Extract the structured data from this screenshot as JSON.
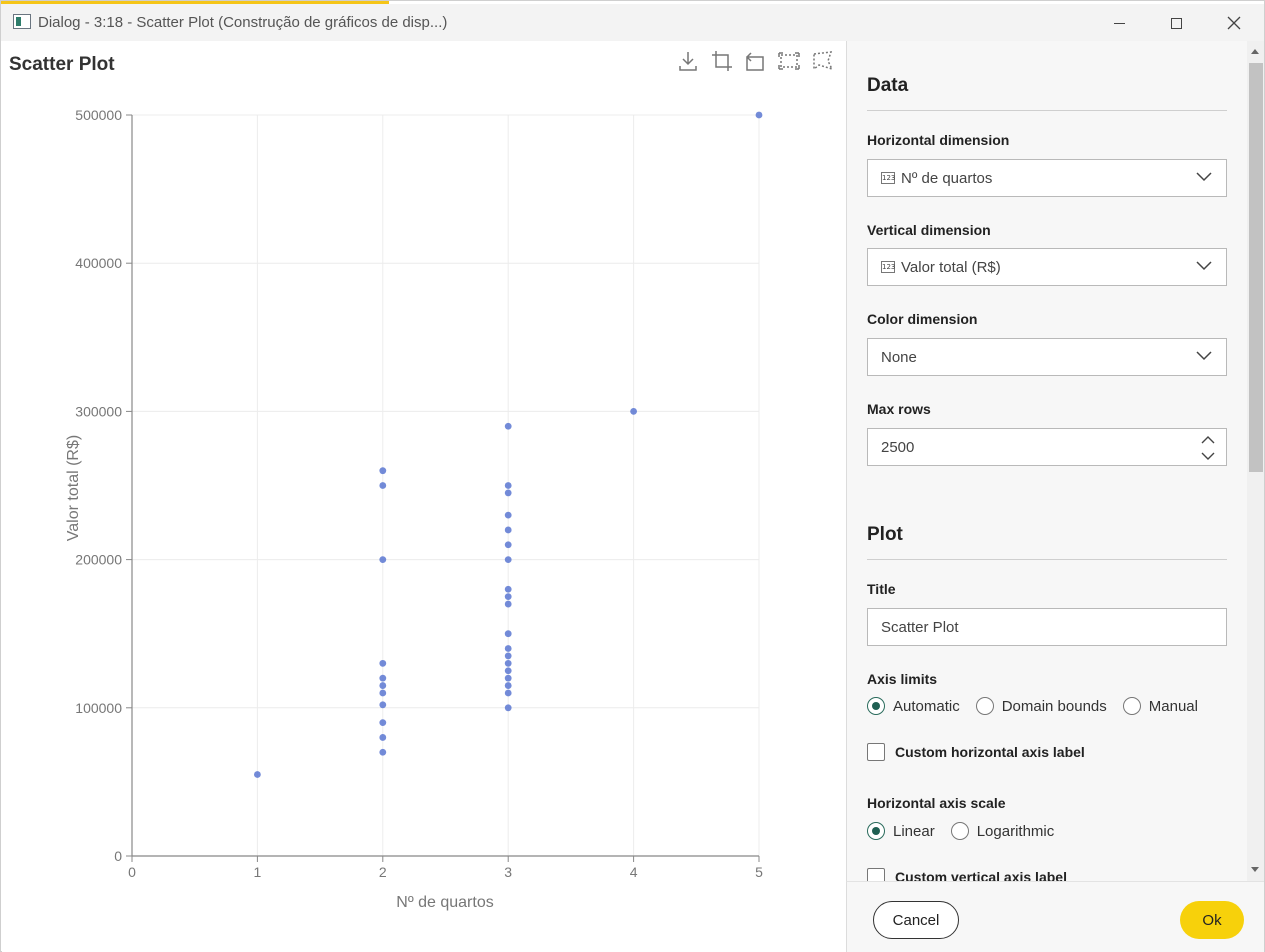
{
  "window": {
    "title": "Dialog - 3:18 - Scatter Plot (Construção de gráficos de disp...)",
    "accent_color": "#f5c518"
  },
  "toolbar": {
    "icons": [
      "download-icon",
      "crop-icon",
      "undo-icon",
      "box-select-icon",
      "lasso-select-icon"
    ]
  },
  "plot": {
    "title": "Scatter Plot"
  },
  "chart_data": {
    "type": "scatter",
    "xlabel": "Nº de quartos",
    "ylabel": "Valor total (R$)",
    "xlim": [
      0,
      5
    ],
    "ylim": [
      0,
      500000
    ],
    "xticks": [
      "0",
      "1",
      "2",
      "3",
      "4",
      "5"
    ],
    "yticks": [
      "0",
      "100000",
      "200000",
      "300000",
      "400000",
      "500000"
    ],
    "grid": true,
    "point_color": "#5b77d1",
    "points": [
      [
        1,
        55000
      ],
      [
        2,
        70000
      ],
      [
        2,
        80000
      ],
      [
        2,
        90000
      ],
      [
        2,
        102000
      ],
      [
        2,
        110000
      ],
      [
        2,
        115000
      ],
      [
        2,
        120000
      ],
      [
        2,
        130000
      ],
      [
        2,
        200000
      ],
      [
        2,
        250000
      ],
      [
        2,
        260000
      ],
      [
        3,
        100000
      ],
      [
        3,
        110000
      ],
      [
        3,
        115000
      ],
      [
        3,
        120000
      ],
      [
        3,
        125000
      ],
      [
        3,
        130000
      ],
      [
        3,
        135000
      ],
      [
        3,
        140000
      ],
      [
        3,
        150000
      ],
      [
        3,
        170000
      ],
      [
        3,
        175000
      ],
      [
        3,
        180000
      ],
      [
        3,
        200000
      ],
      [
        3,
        210000
      ],
      [
        3,
        220000
      ],
      [
        3,
        230000
      ],
      [
        3,
        245000
      ],
      [
        3,
        250000
      ],
      [
        3,
        290000
      ],
      [
        4,
        300000
      ],
      [
        5,
        500000
      ]
    ]
  },
  "sidebar": {
    "data_section": {
      "title": "Data",
      "horizontal_label": "Horizontal dimension",
      "horizontal_value": "Nº de quartos",
      "vertical_label": "Vertical dimension",
      "vertical_value": "Valor total (R$)",
      "color_label": "Color dimension",
      "color_value": "None",
      "max_rows_label": "Max rows",
      "max_rows_value": "2500"
    },
    "plot_section": {
      "title": "Plot",
      "title_label": "Title",
      "title_value": "Scatter Plot",
      "axis_limits_label": "Axis limits",
      "axis_limits_options": [
        "Automatic",
        "Domain bounds",
        "Manual"
      ],
      "custom_h_label": "Custom horizontal axis label",
      "h_scale_label": "Horizontal axis scale",
      "h_scale_options": [
        "Linear",
        "Logarithmic"
      ],
      "custom_v_label": "Custom vertical axis label"
    }
  },
  "footer": {
    "cancel_label": "Cancel",
    "ok_label": "Ok",
    "ok_color": "#f7d10b"
  }
}
